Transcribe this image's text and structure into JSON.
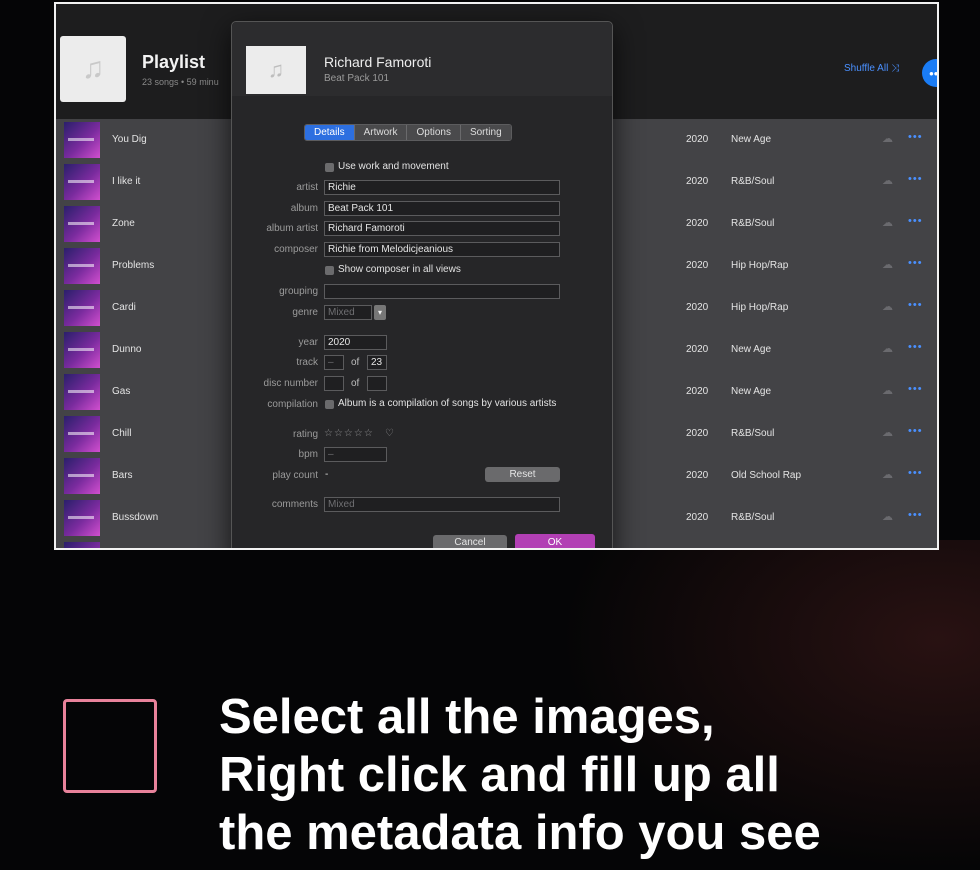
{
  "playlist": {
    "title": "Playlist",
    "subtitle": "23 songs • 59 minu",
    "art_icon": "music-note-icon",
    "shuffle_label": "Shuffle All",
    "shuffle_icon": "⤨",
    "more_fab": "•••"
  },
  "songs": [
    {
      "name": "You Dig",
      "year": "2020",
      "genre": "New Age"
    },
    {
      "name": "I like it",
      "year": "2020",
      "genre": "R&B/Soul"
    },
    {
      "name": "Zone",
      "year": "2020",
      "genre": "R&B/Soul"
    },
    {
      "name": "Problems",
      "year": "2020",
      "genre": "Hip Hop/Rap"
    },
    {
      "name": "Cardi",
      "year": "2020",
      "genre": "Hip Hop/Rap"
    },
    {
      "name": "Dunno",
      "year": "2020",
      "genre": "New Age"
    },
    {
      "name": "Gas",
      "year": "2020",
      "genre": "New Age"
    },
    {
      "name": "Chill",
      "year": "2020",
      "genre": "R&B/Soul"
    },
    {
      "name": "Bars",
      "year": "2020",
      "genre": "Old School Rap"
    },
    {
      "name": "Bussdown",
      "year": "2020",
      "genre": "R&B/Soul"
    }
  ],
  "row_more": "•••",
  "dialog": {
    "title": "Richard Famoroti",
    "subtitle": "Beat Pack 101",
    "tabs": [
      "Details",
      "Artwork",
      "Options",
      "Sorting"
    ],
    "use_work_label": "Use work and movement",
    "artist_label": "artist",
    "artist": "Richie",
    "album_label": "album",
    "album": "Beat Pack 101",
    "album_artist_label": "album artist",
    "album_artist": "Richard Famoroti",
    "composer_label": "composer",
    "composer": "Richie from Melodicjeanious",
    "show_composer_label": "Show composer in all views",
    "grouping_label": "grouping",
    "grouping": "",
    "genre_label": "genre",
    "genre": "Mixed",
    "year_label": "year",
    "year": "2020",
    "track_label": "track",
    "track_num": "–",
    "of_label": "of",
    "track_total": "23",
    "disc_label": "disc number",
    "disc_num": "",
    "disc_total": "",
    "compilation_label": "compilation",
    "compilation_text": "Album is a compilation of songs by various artists",
    "rating_label": "rating",
    "stars": "☆☆☆☆☆",
    "heart": "♡",
    "bpm_label": "bpm",
    "bpm": "–",
    "play_count_label": "play count",
    "play_count": "-",
    "reset_label": "Reset",
    "comments_label": "comments",
    "comments": "Mixed",
    "cancel_label": "Cancel",
    "ok_label": "OK"
  },
  "caption": {
    "line1": "Select all the images,",
    "line2": "Right click and fill up all",
    "line3": "the metadata info you see"
  },
  "colors": {
    "accent": "#2d6fe0",
    "ok_button": "#b23fb4",
    "frame_border": "#f2f2f2",
    "caption_box": "#e8829a"
  }
}
